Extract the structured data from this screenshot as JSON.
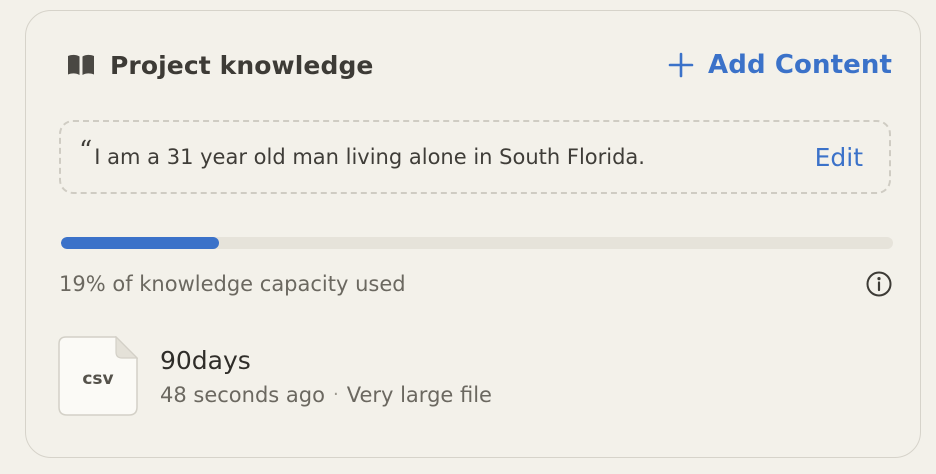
{
  "header": {
    "title": "Project knowledge",
    "title_icon": "open-book-icon",
    "add_button_label": "Add Content",
    "add_button_icon": "plus-icon"
  },
  "instructions": {
    "quote_mark": "“",
    "text": "I am a 31 year old man living alone in South Florida.",
    "edit_label": "Edit"
  },
  "capacity": {
    "used_fraction": 0.19,
    "label": "19% of knowledge capacity used",
    "info_icon": "info-icon"
  },
  "files": [
    {
      "type_label": "csv",
      "name": "90days",
      "uploaded": "48 seconds ago",
      "separator": "·",
      "size_note": "Very large file"
    }
  ],
  "colors": {
    "accent": "#3b72c9",
    "background": "#f3f1ea",
    "text_primary": "#3d3b36",
    "text_secondary": "#6b6860",
    "track": "#e6e3da"
  }
}
